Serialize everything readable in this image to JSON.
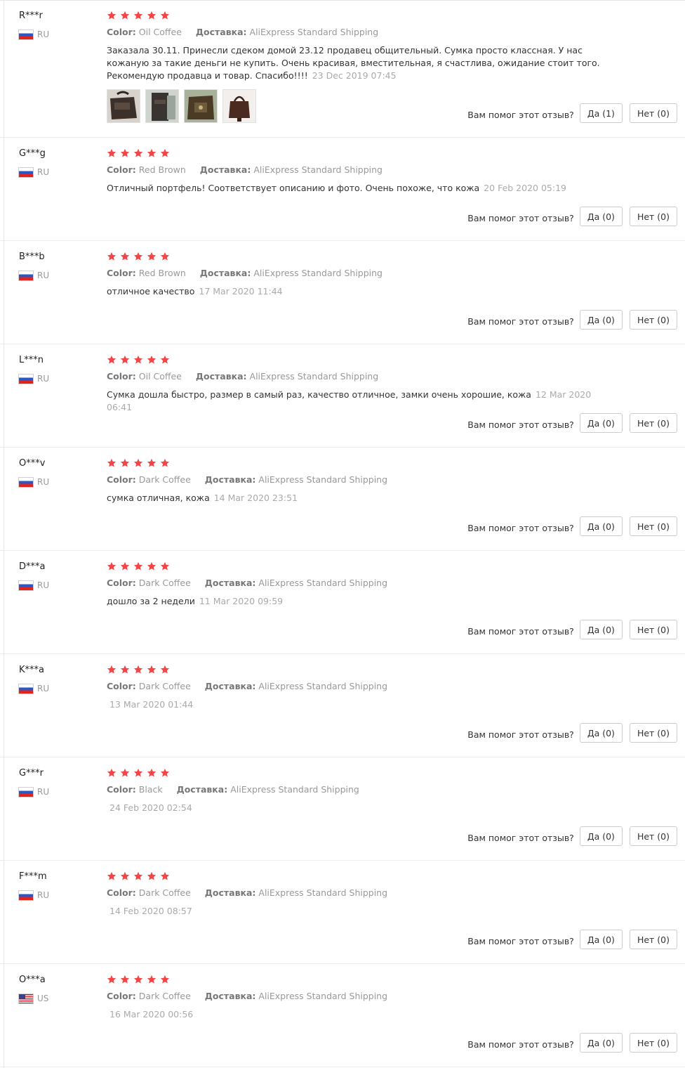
{
  "labels": {
    "color_label": "Color:",
    "shipping_label": "Доставка:",
    "helpful_question": "Вам помог этот отзыв?",
    "yes_label": "Да",
    "no_label": "Нет"
  },
  "colors": {
    "star": "#f44646",
    "accent_text": "#999999"
  },
  "reviews": [
    {
      "user": "R***r",
      "country": "RU",
      "stars": 5,
      "color": "Oil Coffee",
      "shipping": "AliExpress Standard Shipping",
      "text": "Заказала 30.11. Принесли сдеком домой 23.12 продавец общительный. Сумка просто классная. У нас кожаную за такие деньги не купить. Очень красивая, вместительная, я счастлива, ожидание стоит того. Рекомендую продавца и товар. Спасибо!!!!",
      "date": "23 Dec 2019 07:45",
      "yes": "Да (1)",
      "no": "Нет (0)"
    },
    {
      "user": "G***g",
      "country": "RU",
      "stars": 5,
      "color": "Red Brown",
      "shipping": "AliExpress Standard Shipping",
      "text": "Отличный портфель! Соответствует описанию и фото. Очень похоже, что кожа",
      "date": "20 Feb 2020 05:19",
      "yes": "Да (0)",
      "no": "Нет (0)"
    },
    {
      "user": "B***b",
      "country": "RU",
      "stars": 5,
      "color": "Red Brown",
      "shipping": "AliExpress Standard Shipping",
      "text": "отличное качество",
      "date": "17 Mar 2020 11:44",
      "yes": "Да (0)",
      "no": "Нет (0)"
    },
    {
      "user": "L***n",
      "country": "RU",
      "stars": 5,
      "color": "Oil Coffee",
      "shipping": "AliExpress Standard Shipping",
      "text": "Сумка дошла быстро, размер в самый раз, качество отличное, замки очень хорошие, кожа",
      "date": "12 Mar 2020 06:41",
      "yes": "Да (0)",
      "no": "Нет (0)"
    },
    {
      "user": "O***v",
      "country": "RU",
      "stars": 5,
      "color": "Dark Coffee",
      "shipping": "AliExpress Standard Shipping",
      "text": "сумка отличная, кожа",
      "date": "14 Mar 2020 23:51",
      "yes": "Да (0)",
      "no": "Нет (0)"
    },
    {
      "user": "D***a",
      "country": "RU",
      "stars": 5,
      "color": "Dark Coffee",
      "shipping": "AliExpress Standard Shipping",
      "text": "дошло за 2 недели",
      "date": "11 Mar 2020 09:59",
      "yes": "Да (0)",
      "no": "Нет (0)"
    },
    {
      "user": "K***a",
      "country": "RU",
      "stars": 5,
      "color": "Dark Coffee",
      "shipping": "AliExpress Standard Shipping",
      "text": "",
      "date": "13 Mar 2020 01:44",
      "yes": "Да (0)",
      "no": "Нет (0)"
    },
    {
      "user": "G***r",
      "country": "RU",
      "stars": 5,
      "color": "Black",
      "shipping": "AliExpress Standard Shipping",
      "text": "",
      "date": "24 Feb 2020 02:54",
      "yes": "Да (0)",
      "no": "Нет (0)"
    },
    {
      "user": "F***m",
      "country": "RU",
      "stars": 5,
      "color": "Dark Coffee",
      "shipping": "AliExpress Standard Shipping",
      "text": "",
      "date": "14 Feb 2020 08:57",
      "yes": "Да (0)",
      "no": "Нет (0)"
    },
    {
      "user": "O***a",
      "country": "US",
      "stars": 5,
      "color": "Dark Coffee",
      "shipping": "AliExpress Standard Shipping",
      "text": "",
      "date": "16 Mar 2020 00:56",
      "yes": "Да (0)",
      "no": "Нет (0)"
    }
  ]
}
